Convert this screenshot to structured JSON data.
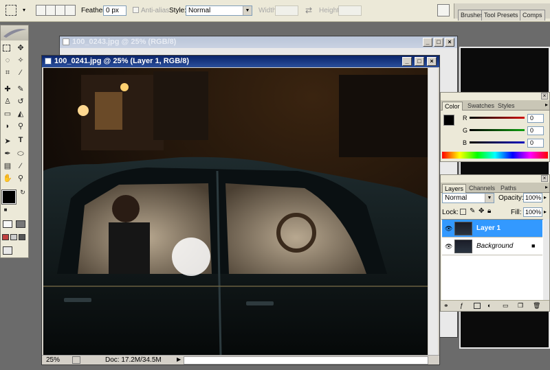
{
  "options_bar": {
    "feather_label": "Feather:",
    "feather_value": "0 px",
    "antialias_label": "Anti-alias",
    "style_label": "Style:",
    "style_value": "Normal",
    "width_label": "Width:",
    "height_label": "Height:",
    "palette_well_tabs": [
      "Brushes",
      "Tool Presets",
      "Comps"
    ]
  },
  "back_window": {
    "title": "100_0243.jpg @ 25% (RGB/8)"
  },
  "front_window": {
    "title": "100_0241.jpg @ 25% (Layer 1, RGB/8)",
    "zoom": "25%",
    "doc_size": "Doc: 17.2M/34.5M"
  },
  "color_panel": {
    "tabs": [
      "Color",
      "Swatches",
      "Styles"
    ],
    "channels": [
      {
        "label": "R",
        "value": "0",
        "color": "#d01010"
      },
      {
        "label": "G",
        "value": "0",
        "color": "#10a010"
      },
      {
        "label": "B",
        "value": "0",
        "color": "#1010c0"
      }
    ]
  },
  "layers_panel": {
    "tabs": [
      "Layers",
      "Channels",
      "Paths"
    ],
    "blend_mode": "Normal",
    "opacity_label": "Opacity:",
    "opacity_value": "100%",
    "lock_label": "Lock:",
    "fill_label": "Fill:",
    "fill_value": "100%",
    "layers": [
      {
        "name": "Layer 1",
        "selected": true
      },
      {
        "name": "Background",
        "selected": false
      }
    ]
  },
  "colors": {
    "selection": "#3399ff",
    "titlebar": "#0a246a"
  }
}
